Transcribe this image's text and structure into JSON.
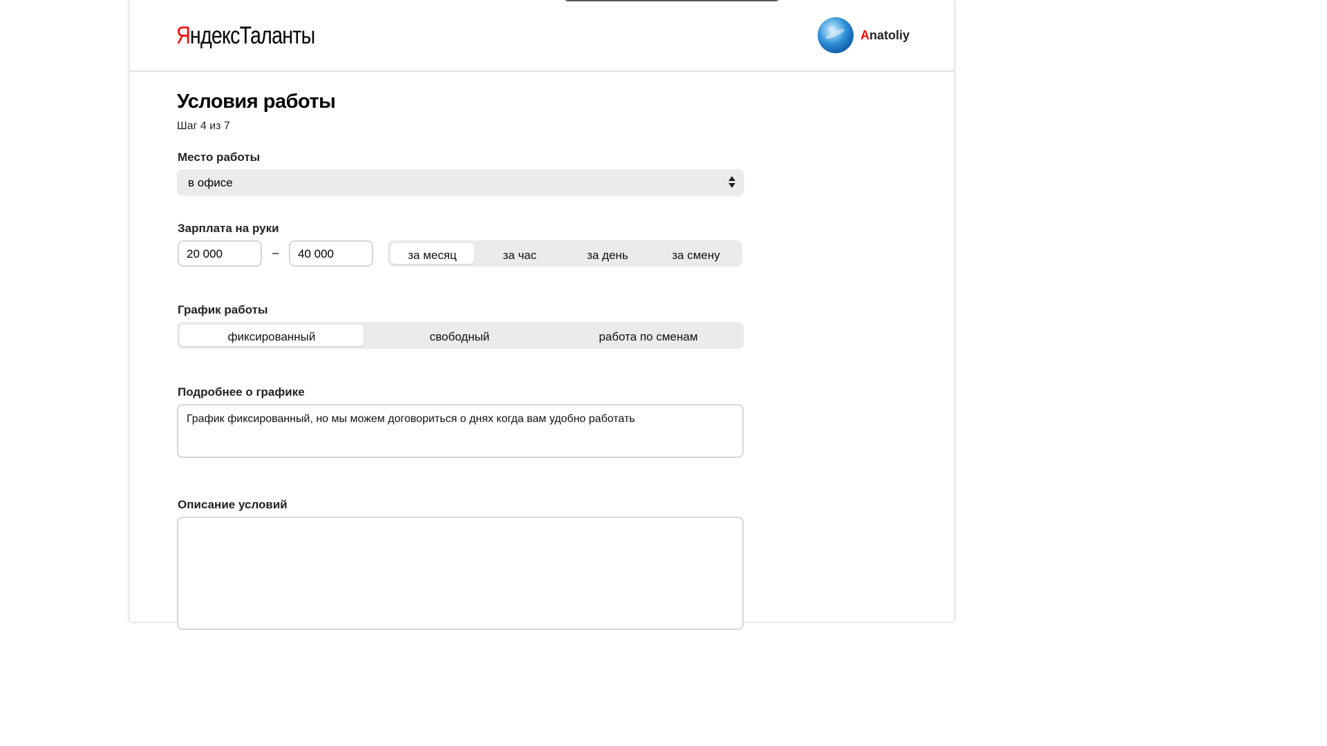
{
  "header": {
    "logo_brand_first": "Я",
    "logo_brand_rest": "ндекс",
    "logo_product": "Таланты",
    "user": {
      "name_first_letter": "A",
      "name_rest": "natoliy"
    }
  },
  "page": {
    "title": "Условия работы",
    "step": "Шаг 4 из 7"
  },
  "workplace": {
    "label": "Место работы",
    "selected": "в офисе"
  },
  "salary": {
    "label": "Зарплата на руки",
    "from": "20 000",
    "separator": "–",
    "to": "40 000",
    "periods": [
      "за месяц",
      "за час",
      "за день",
      "за смену"
    ],
    "selected_period": "за месяц"
  },
  "schedule": {
    "label": "График работы",
    "options": [
      "фиксированный",
      "свободный",
      "работа по сменам"
    ],
    "selected": "фиксированный"
  },
  "schedule_details": {
    "label": "Подробнее о графике",
    "value": "График фиксированный, но мы можем договориться о днях когда вам удобно работать"
  },
  "conditions": {
    "label": "Описание условий",
    "value": ""
  },
  "colors": {
    "brand_red": "#ff0000",
    "field_background": "#ebebeb",
    "border": "#d6d6d6"
  }
}
